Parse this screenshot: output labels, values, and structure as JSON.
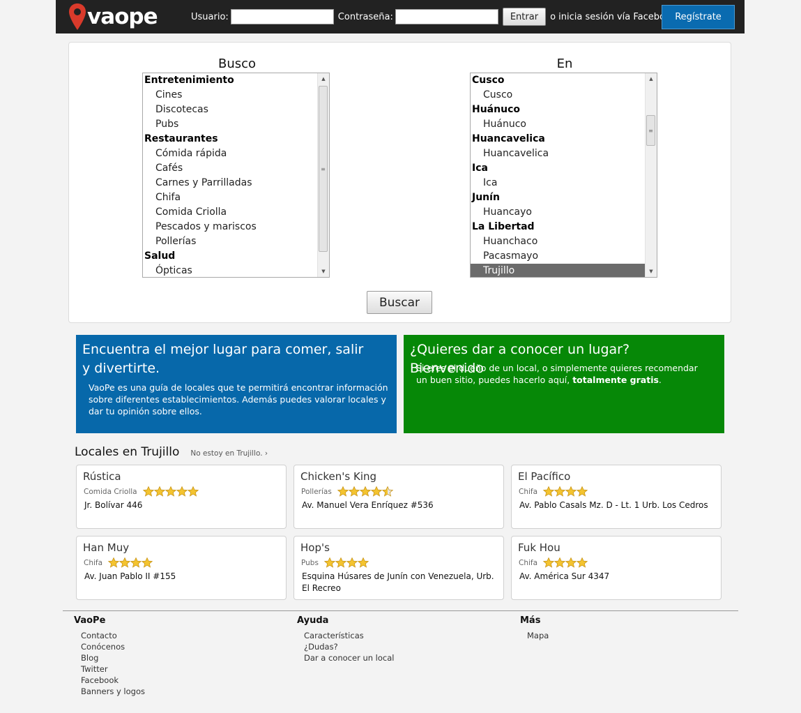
{
  "header": {
    "logo_text": "vaope",
    "user_label": "Usuario:",
    "password_label": "Contraseña:",
    "login_button": "Entrar",
    "facebook_text": "o inicia sesión vía Facebook",
    "register_button": "Regístrate"
  },
  "search": {
    "busco_title": "Busco",
    "en_title": "En",
    "busco_items": [
      {
        "label": "Entretenimiento",
        "group": true
      },
      {
        "label": "Cines",
        "group": false
      },
      {
        "label": "Discotecas",
        "group": false
      },
      {
        "label": "Pubs",
        "group": false
      },
      {
        "label": "Restaurantes",
        "group": true
      },
      {
        "label": "Cómida rápida",
        "group": false
      },
      {
        "label": "Cafés",
        "group": false
      },
      {
        "label": "Carnes y Parrilladas",
        "group": false
      },
      {
        "label": "Chifa",
        "group": false
      },
      {
        "label": "Comida Criolla",
        "group": false
      },
      {
        "label": "Pescados y mariscos",
        "group": false
      },
      {
        "label": "Pollerías",
        "group": false
      },
      {
        "label": "Salud",
        "group": true
      },
      {
        "label": "Ópticas",
        "group": false
      }
    ],
    "en_items": [
      {
        "label": "Cusco",
        "group": true
      },
      {
        "label": "Cusco",
        "group": false
      },
      {
        "label": "Huánuco",
        "group": true
      },
      {
        "label": "Huánuco",
        "group": false
      },
      {
        "label": "Huancavelica",
        "group": true
      },
      {
        "label": "Huancavelica",
        "group": false
      },
      {
        "label": "Ica",
        "group": true
      },
      {
        "label": "Ica",
        "group": false
      },
      {
        "label": "Junín",
        "group": true
      },
      {
        "label": "Huancayo",
        "group": false
      },
      {
        "label": "La Libertad",
        "group": true
      },
      {
        "label": "Huanchaco",
        "group": false
      },
      {
        "label": "Pacasmayo",
        "group": false
      },
      {
        "label": "Trujillo",
        "group": false,
        "selected": true
      }
    ],
    "search_button": "Buscar"
  },
  "promo_blue": {
    "title": "Encuentra el mejor lugar para comer, salir y divertirte.",
    "text": "VaoPe es una guía de locales que te permitirá encontrar información sobre diferentes establecimientos. Además puedes valorar locales y dar tu opinión sobre ellos."
  },
  "promo_green": {
    "title": "¿Quieres dar a conocer un lugar? Bienvenido",
    "text_before": "Si eres el dueño de un local, o simplemente quieres recomendar un buen sitio, puedes hacerlo aquí, ",
    "text_bold": "totalmente gratis",
    "text_after": "."
  },
  "locales": {
    "title": "Locales en Trujillo",
    "change_link": "No estoy en Trujillo. ›",
    "cards": [
      {
        "name": "Rústica",
        "category": "Comida Criolla",
        "rating": 5,
        "address": "Jr. Bolívar 446"
      },
      {
        "name": "Chicken's King",
        "category": "Pollerías",
        "rating": 4.5,
        "address": "Av. Manuel Vera Enríquez #536"
      },
      {
        "name": "El Pacífico",
        "category": "Chifa",
        "rating": 4,
        "address": "Av. Pablo Casals Mz. D - Lt. 1 Urb. Los Cedros"
      },
      {
        "name": "Han Muy",
        "category": "Chifa",
        "rating": 4,
        "address": "Av. Juan Pablo II #155"
      },
      {
        "name": "Hop's",
        "category": "Pubs",
        "rating": 4,
        "address": "Esquina Húsares de Junín con Venezuela, Urb. El Recreo"
      },
      {
        "name": "Fuk Hou",
        "category": "Chifa",
        "rating": 4,
        "address": "Av. América Sur 4347"
      }
    ]
  },
  "footer": {
    "col1": {
      "title": "VaoPe",
      "links": [
        "Contacto",
        "Conócenos",
        "Blog",
        "Twitter",
        "Facebook",
        "Banners y logos"
      ]
    },
    "col2": {
      "title": "Ayuda",
      "links": [
        "Características",
        "¿Dudas?",
        "Dar a conocer un local"
      ]
    },
    "col3": {
      "title": "Más",
      "links": [
        "Mapa"
      ]
    }
  },
  "colors": {
    "header_bg": "#222222",
    "register_blue": "#0a6bb0",
    "promo_blue": "#0768aa",
    "promo_green": "#068807",
    "star_gold": "#f4c430",
    "logo_pin_red": "#d93a2b"
  }
}
